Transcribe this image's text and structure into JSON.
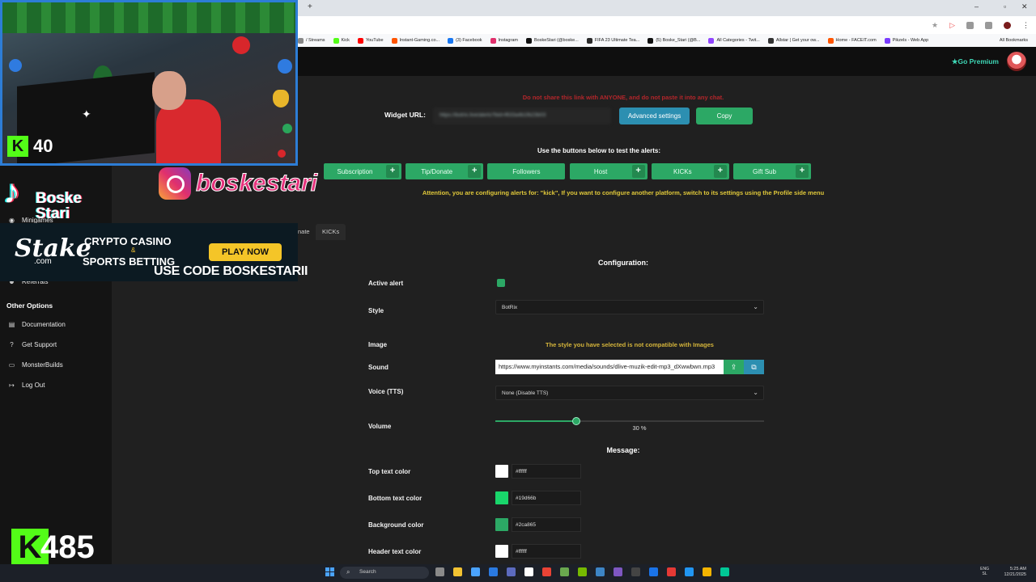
{
  "browser": {
    "bookmarks": [
      {
        "label": "/ Streams",
        "color": "#888888"
      },
      {
        "label": "Kick",
        "color": "#53fc18"
      },
      {
        "label": "YouTube",
        "color": "#ff0000"
      },
      {
        "label": "Instant-Gaming.co...",
        "color": "#ff5400"
      },
      {
        "label": "(3) Facebook",
        "color": "#1877f2"
      },
      {
        "label": "Instagram",
        "color": "#e1306c"
      },
      {
        "label": "BoskeStari (@boske...",
        "color": "#111111"
      },
      {
        "label": "FIFA 23 Ultimate Tea...",
        "color": "#2b2b2b"
      },
      {
        "label": "(5) Boske_Stari (@B...",
        "color": "#111111"
      },
      {
        "label": "All Categories - Twit...",
        "color": "#9146ff"
      },
      {
        "label": "Allstar | Get your ow...",
        "color": "#333333"
      },
      {
        "label": "Home - FACEIT.com",
        "color": "#ff5500"
      },
      {
        "label": "Pikzels - Web App",
        "color": "#7a3cff"
      }
    ],
    "all_bookmarks": "All Bookmarks",
    "new_tab": "+"
  },
  "header": {
    "go_premium": "Go Premium"
  },
  "widget": {
    "warning": "Do not share this link with ANYONE, and do not paste it into any chat.",
    "url_label": "Widget URL:",
    "url_value": "https://botrix.live/alerts?bid=f633a4b1fb23b03",
    "advanced_settings": "Advanced settings",
    "copy": "Copy",
    "test_label": "Use the buttons below to test the alerts:",
    "attention": "Attention, you are configuring alerts for: \"kick\", If you want to configure another platform, switch to its settings using the Profile side menu"
  },
  "alert_buttons": [
    {
      "label": "Subscription",
      "has_plus": true
    },
    {
      "label": "Tip/Donate",
      "has_plus": true
    },
    {
      "label": "Followers",
      "has_plus": false
    },
    {
      "label": "Host",
      "has_plus": true
    },
    {
      "label": "KICKs",
      "has_plus": true
    },
    {
      "label": "Gift Sub",
      "has_plus": true
    }
  ],
  "tabs": {
    "donate_partial": "nate",
    "kicks": "KICKs"
  },
  "config": {
    "title": "Configuration:",
    "active_alert_label": "Active alert",
    "active_alert_checked": true,
    "style_label": "Style",
    "style_value": "BotRix",
    "image_label": "Image",
    "image_note": "The style you have selected is not compatible with Images",
    "sound_label": "Sound",
    "sound_value": "https://www.myinstants.com/media/sounds/dlive-muzik-edit-mp3_dXwwbwn.mp3",
    "voice_label": "Voice (TTS)",
    "voice_value": "None (Disable TTS)",
    "volume_label": "Volume",
    "volume_percent": 30,
    "volume_text": "30 %"
  },
  "message": {
    "title": "Message:",
    "colors": [
      {
        "label": "Top text color",
        "value": "#ffffff"
      },
      {
        "label": "Bottom text color",
        "value": "#19d66b"
      },
      {
        "label": "Background color",
        "value": "#2ca865"
      },
      {
        "label": "Header text color",
        "value": "#ffffff"
      }
    ]
  },
  "sidebar": {
    "partial_items": [
      {
        "label": "Minigames",
        "icon": "gamepad-icon"
      },
      {
        "label": "Referrals",
        "icon": "users-icon"
      }
    ],
    "other_options_title": "Other Options",
    "other_options": [
      {
        "label": "Documentation",
        "icon": "book-icon"
      },
      {
        "label": "Get Support",
        "icon": "help-icon"
      },
      {
        "label": "MonsterBuilds",
        "icon": "monitor-icon"
      },
      {
        "label": "Log Out",
        "icon": "logout-icon"
      }
    ]
  },
  "overlays": {
    "kick_viewer_count": "40",
    "instagram_handle": "boskestari",
    "tiktok_name_line1": "Boske",
    "tiktok_name_line2": "Stari",
    "stake_logo": "Stake",
    "stake_com": ".com",
    "stake_line1": "CRYPTO CASINO",
    "stake_amp": "&",
    "stake_line2": "SPORTS BETTING",
    "stake_play": "PLAY NOW",
    "stake_code": "USE CODE BOSKESTARII",
    "kick_followers": "485",
    "kick_name": "boskestari"
  },
  "taskbar": {
    "search_placeholder": "Search",
    "lang_line1": "ENG",
    "lang_line2": "SL",
    "time": "5:25 AM",
    "date": "12/21/2025"
  }
}
